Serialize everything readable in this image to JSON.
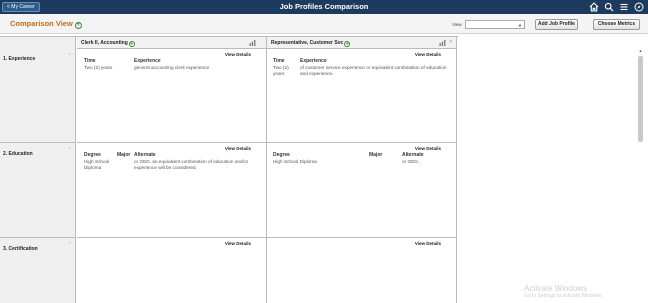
{
  "banner": {
    "back_label": "< My Career",
    "title": "Job Profiles Comparison",
    "icons": [
      "home-icon",
      "search-icon",
      "menu-icon",
      "navbar-compass-icon"
    ]
  },
  "header": {
    "title": "Comparison View",
    "view_label": "View",
    "view_value": "",
    "add_button": "Add Job Profile",
    "choose_button": "Choose Metrics"
  },
  "sections": [
    {
      "label": "1. Experience"
    },
    {
      "label": "2. Education"
    },
    {
      "label": "3. Certification"
    }
  ],
  "jobs": [
    {
      "title": "Clerk II, Accounting",
      "view_details": "View Details",
      "experience": {
        "col1": "Time",
        "col2": "Experience",
        "time": "Two (2) years",
        "text": "general accounting clerk experience"
      },
      "education": {
        "col1": "Degree",
        "col2": "Major",
        "col3": "Alternate",
        "degree": "High School Diploma",
        "major": "",
        "alternate": "or GED, an equivalent combination of education and/or experience will be considered."
      },
      "certification": {
        "view_details": "View Details"
      }
    },
    {
      "title": "Representative, Customer Svc",
      "view_details": "View Details",
      "experience": {
        "col1": "Time",
        "col2": "Experience",
        "time": "Two (2) years",
        "text": "of customer service experience or equivalent combination of education and experience."
      },
      "education": {
        "col1": "Degree",
        "col2": "Major",
        "col3": "Alternate",
        "degree": "High School Diploma",
        "major": "",
        "alternate": "or GED."
      },
      "certification": {
        "view_details": "View Details"
      }
    }
  ],
  "watermark": {
    "line1": "Activate Windows",
    "line2": "Go to Settings to activate Windows."
  },
  "colors": {
    "banner": "#1c3a5e",
    "title": "#c46a1a",
    "plus": "#3a8a3a"
  }
}
